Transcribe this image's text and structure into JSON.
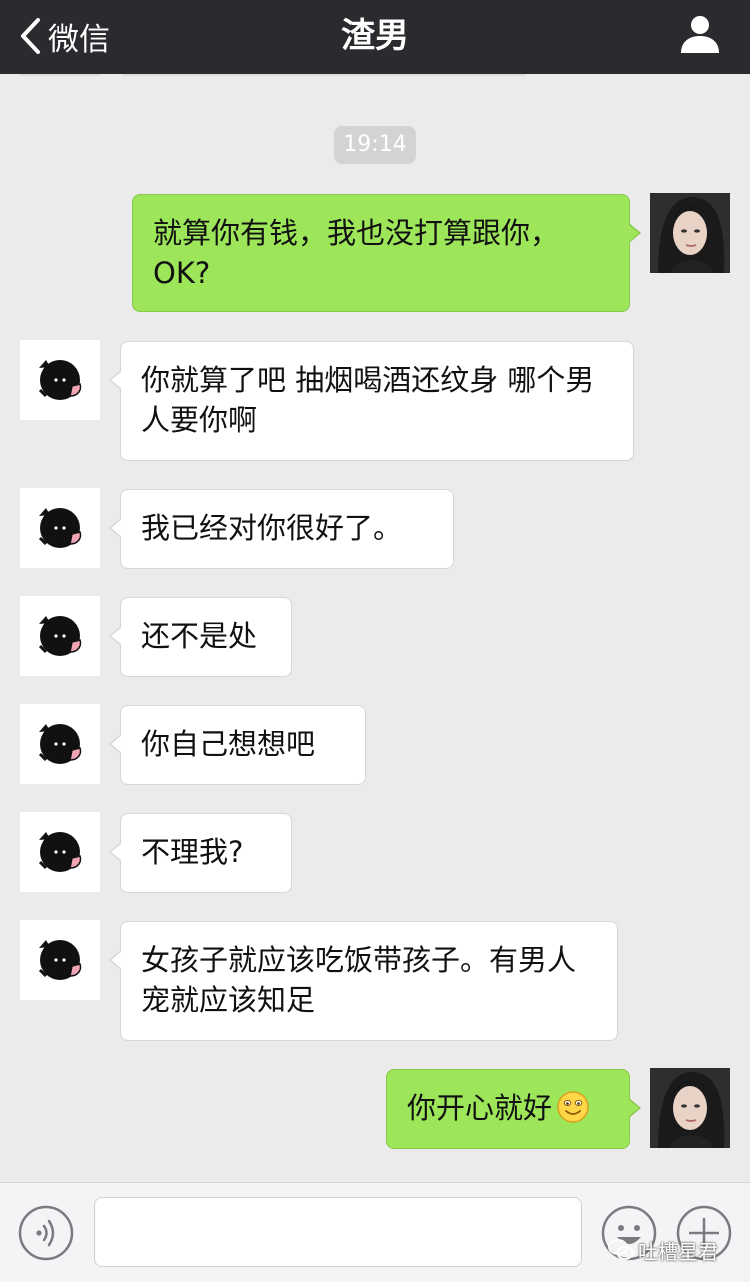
{
  "header": {
    "back_label": "微信",
    "title": "渣男"
  },
  "chat": {
    "timestamp": "19:14",
    "messages": [
      {
        "side": "out",
        "text": "就算你有钱，我也没打算跟你，OK?"
      },
      {
        "side": "in",
        "text": "你就算了吧 抽烟喝酒还纹身 哪个男人要你啊"
      },
      {
        "side": "in",
        "text": "我已经对你很好了。"
      },
      {
        "side": "in",
        "text": "还不是处"
      },
      {
        "side": "in",
        "text": "你自己想想吧"
      },
      {
        "side": "in",
        "text": "不理我?"
      },
      {
        "side": "in",
        "text": "女孩子就应该吃饭带孩子。有男人宠就应该知足"
      },
      {
        "side": "out",
        "text": "你开心就好",
        "emoji": "smile-emoji"
      }
    ]
  },
  "input": {
    "value": "",
    "placeholder": ""
  },
  "watermark": {
    "text": "吐槽星君",
    "icon": "wechat-logo-icon"
  },
  "icons": {
    "back": "chevron-left-icon",
    "profile": "person-icon",
    "voice": "voice-icon",
    "emoji_button": "smiley-face-icon",
    "more": "plus-icon"
  },
  "colors": {
    "header_bg": "#2b2b2f",
    "chat_bg": "#ebebeb",
    "bubble_out": "#9de65a",
    "bubble_in": "#ffffff"
  }
}
